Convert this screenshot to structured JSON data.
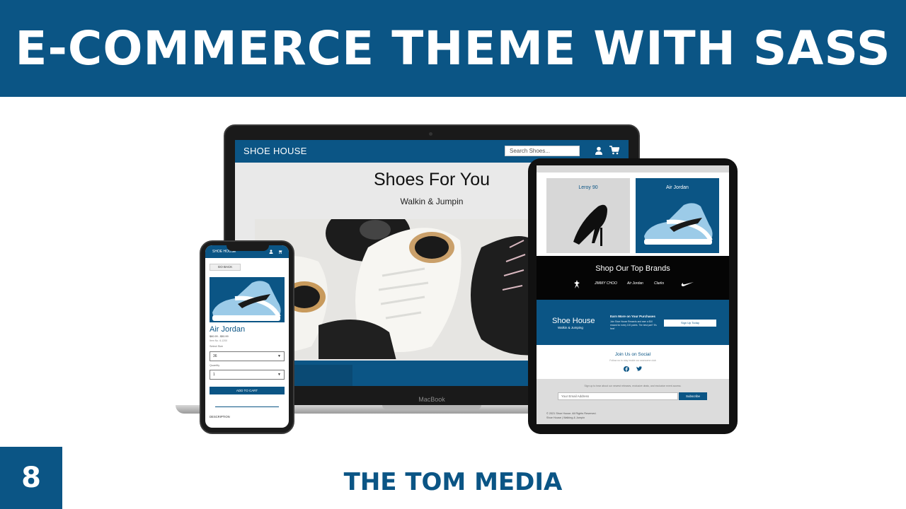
{
  "banner": {
    "title": "E-COMMERCE THEME WITH SASS"
  },
  "episode": {
    "number": "8"
  },
  "brand": {
    "name": "THE TOM MEDIA"
  },
  "colors": {
    "primary": "#0b5585",
    "black": "#050505",
    "white": "#ffffff"
  },
  "laptop": {
    "device_label": "MacBook",
    "nav": {
      "logo": "SHOE HOUSE",
      "search_placeholder": "Search Shoes..."
    },
    "hero": {
      "title": "Shoes For You",
      "subtitle": "Walkin & Jumpin"
    }
  },
  "tablet": {
    "cards": [
      {
        "label": "Leroy 90"
      },
      {
        "label": "Air Jordan"
      }
    ],
    "brands": {
      "title": "Shop Our Top Brands",
      "logos": [
        "jordan-logo",
        "JIMMY CHOO",
        "Air Jordan",
        "Clarks",
        "nike-logo"
      ]
    },
    "promo": {
      "name": "Shoe House",
      "tagline": "Walkin & Jumping",
      "heading": "Earn More on Your Purchases",
      "text": "Join Shoe House Rewards and earn a $10 reward for every 100 points. The best part? It's free!",
      "button": "Sign Up Today"
    },
    "social": {
      "title": "Join Us on Social",
      "subtitle": "Follow us to stay inside our awesome club",
      "icons": [
        "facebook-icon",
        "twitter-icon"
      ]
    },
    "newsletter": {
      "text": "Sign up to hear about our newest releases, exclusive deals, and exclusive event access.",
      "placeholder": "Your Email Address",
      "button": "Subscribe"
    },
    "copyright": {
      "line1": "© 2021 Shoe House. All Rights Reserved.",
      "line2": "Shoe House | Walking & Jumpin"
    }
  },
  "phone": {
    "nav": {
      "logo": "SHOE HOUSE"
    },
    "back_button": "GO BACK",
    "product": {
      "title": "Air Jordan",
      "price": "$60.99 - $50.99",
      "item_no": "Item No. 6-1200",
      "size_label": "Select Size",
      "size_value": "36",
      "qty_label": "Quantity",
      "qty_value": "1",
      "add_button": "ADD TO CART",
      "description_label": "DESCRIPTION"
    }
  }
}
